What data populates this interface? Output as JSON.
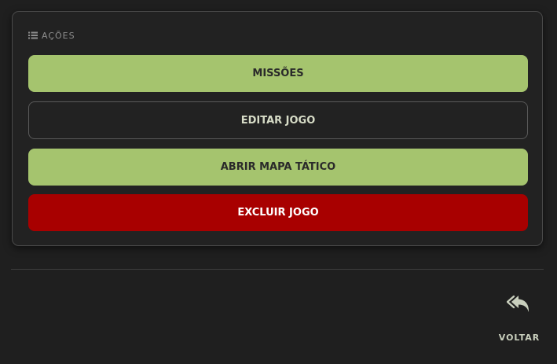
{
  "actions_panel": {
    "title": "AÇÕES",
    "title_icon": "list-icon",
    "buttons": [
      {
        "label": "MISSÕES",
        "style": "filled",
        "color": "#a5c46e"
      },
      {
        "label": "EDITAR JOGO",
        "style": "outline",
        "color": "#5a5a5a"
      },
      {
        "label": "ABRIR MAPA TÁTICO",
        "style": "filled",
        "color": "#a5c46e"
      },
      {
        "label": "EXCLUIR JOGO",
        "style": "filled",
        "color": "#a80000"
      }
    ]
  },
  "footer": {
    "back_label": "VOLTAR",
    "back_icon": "reply-all-icon"
  },
  "colors": {
    "background": "#1f1f1f",
    "accent_green": "#a5c46e",
    "danger_red": "#a80000"
  }
}
